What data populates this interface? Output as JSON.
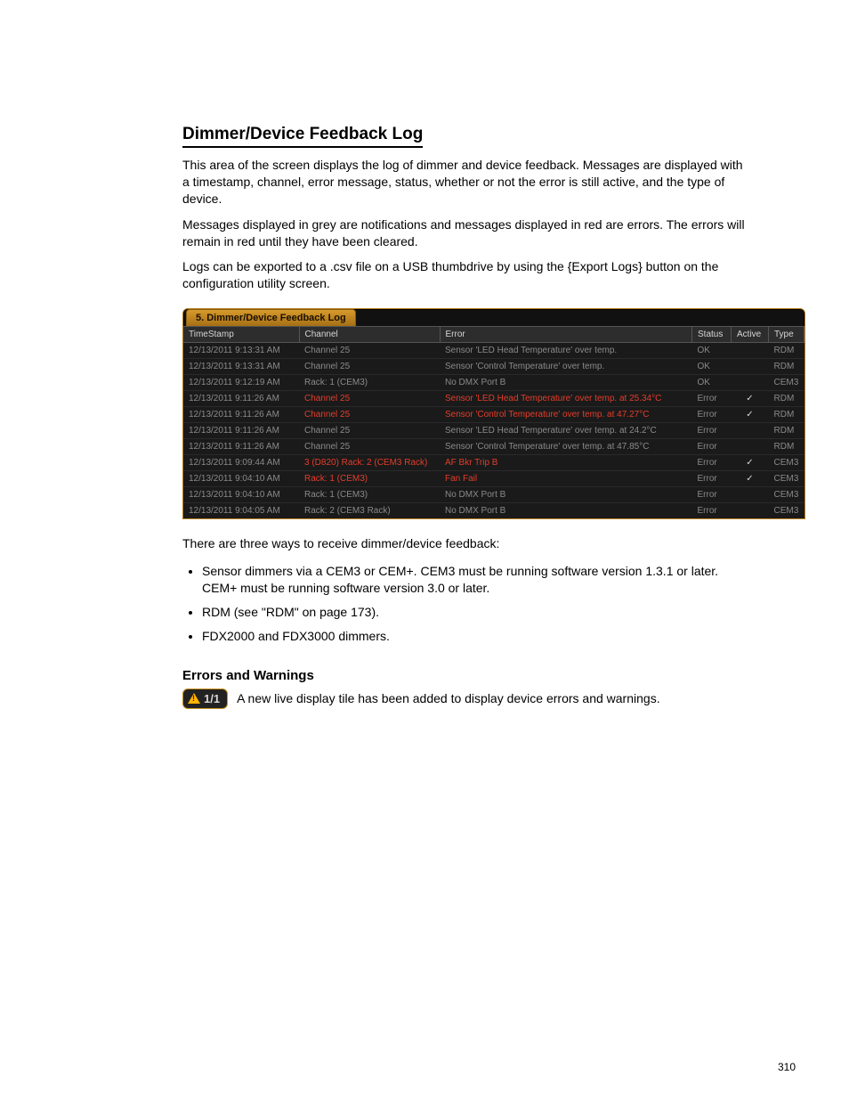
{
  "heading": "Dimmer/Device Feedback Log",
  "intro_paragraphs": [
    "This area of the screen displays the log of dimmer and device feedback. Messages are displayed with a timestamp, channel, error message, status, whether or not the error is still active, and the type of device.",
    "Messages displayed in grey are notifications and messages displayed in red are errors. The errors will remain in red until they have been cleared.",
    "Logs can be exported to a .csv file on a USB thumbdrive by using the {Export Logs} button on the configuration utility screen."
  ],
  "panel_title": "5. Dimmer/Device Feedback Log",
  "columns": {
    "timestamp": "TimeStamp",
    "channel": "Channel",
    "error": "Error",
    "status": "Status",
    "active": "Active",
    "type": "Type"
  },
  "rows": [
    {
      "ts": "12/13/2011 9:13:31 AM",
      "chan": "Channel 25",
      "err": "Sensor 'LED Head Temperature' over temp.",
      "status": "OK",
      "active": "",
      "type": "RDM",
      "cls": ""
    },
    {
      "ts": "12/13/2011 9:13:31 AM",
      "chan": "Channel 25",
      "err": "Sensor 'Control Temperature' over temp.",
      "status": "OK",
      "active": "",
      "type": "RDM",
      "cls": ""
    },
    {
      "ts": "12/13/2011 9:12:19 AM",
      "chan": "Rack: 1 (CEM3)",
      "err": "No DMX Port B",
      "status": "OK",
      "active": "",
      "type": "CEM3",
      "cls": ""
    },
    {
      "ts": "12/13/2011 9:11:26 AM",
      "chan": "Channel 25",
      "err": "Sensor 'LED Head Temperature' over temp.  at 25.34°C",
      "status": "Error",
      "active": "✓",
      "type": "RDM",
      "cls": "error-red"
    },
    {
      "ts": "12/13/2011 9:11:26 AM",
      "chan": "Channel 25",
      "err": "Sensor 'Control Temperature' over temp.  at 47.27°C",
      "status": "Error",
      "active": "✓",
      "type": "RDM",
      "cls": "error-red"
    },
    {
      "ts": "12/13/2011 9:11:26 AM",
      "chan": "Channel 25",
      "err": "Sensor 'LED Head Temperature' over temp.  at 24.2°C",
      "status": "Error",
      "active": "",
      "type": "RDM",
      "cls": ""
    },
    {
      "ts": "12/13/2011 9:11:26 AM",
      "chan": "Channel 25",
      "err": "Sensor 'Control Temperature' over temp.  at 47.85°C",
      "status": "Error",
      "active": "",
      "type": "RDM",
      "cls": ""
    },
    {
      "ts": "12/13/2011 9:09:44 AM",
      "chan": "3 (D820) Rack: 2 (CEM3 Rack)",
      "err": "AF Bkr Trip B",
      "status": "Error",
      "active": "✓",
      "type": "CEM3",
      "cls": "error-red"
    },
    {
      "ts": "12/13/2011 9:04:10 AM",
      "chan": "Rack: 1 (CEM3)",
      "err": "Fan Fail",
      "status": "Error",
      "active": "✓",
      "type": "CEM3",
      "cls": "error-red"
    },
    {
      "ts": "12/13/2011 9:04:10 AM",
      "chan": "Rack: 1 (CEM3)",
      "err": "No DMX Port B",
      "status": "Error",
      "active": "",
      "type": "CEM3",
      "cls": ""
    },
    {
      "ts": "12/13/2011 9:04:05 AM",
      "chan": "Rack: 2 (CEM3 Rack)",
      "err": "No DMX Port B",
      "status": "Error",
      "active": "",
      "type": "CEM3",
      "cls": ""
    }
  ],
  "after_figure": "There are three ways to receive dimmer/device feedback:",
  "bullets": [
    "Sensor dimmers via a CEM3 or CEM+. CEM3 must be running software version 1.3.1 or later. CEM+ must be running software version 3.0 or later.",
    "RDM (see \"RDM\" on page 173).",
    "FDX2000 and FDX3000 dimmers."
  ],
  "sub_heading": "Errors and Warnings",
  "warn_label": "1/1",
  "warn_text": "A new live display tile has been added to display device errors and warnings.",
  "page_number": "310"
}
